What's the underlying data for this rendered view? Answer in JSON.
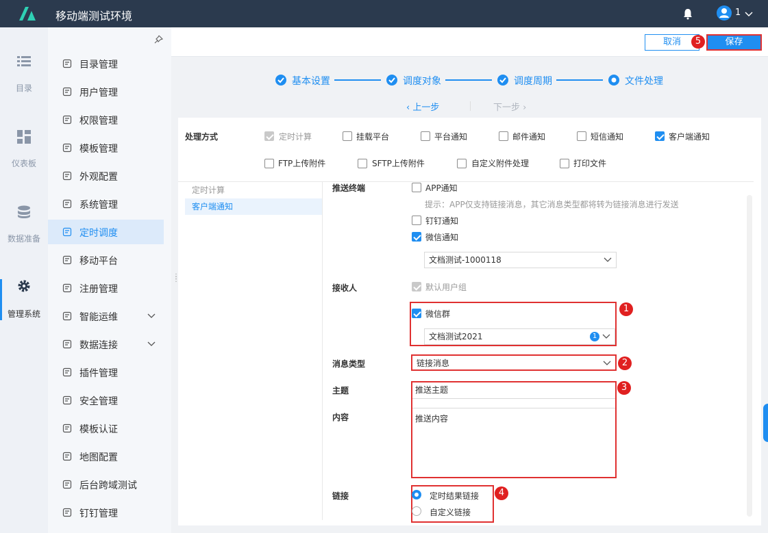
{
  "app": {
    "title": "移动端测试环境",
    "user": "1"
  },
  "rail": [
    {
      "label": "目录",
      "icon": "list-icon"
    },
    {
      "label": "仪表板",
      "icon": "dashboard-icon"
    },
    {
      "label": "数据准备",
      "icon": "database-icon"
    },
    {
      "label": "管理系统",
      "icon": "gear-icon",
      "active": true
    }
  ],
  "sidebar": {
    "items": [
      {
        "label": "目录管理"
      },
      {
        "label": "用户管理"
      },
      {
        "label": "权限管理"
      },
      {
        "label": "模板管理"
      },
      {
        "label": "外观配置"
      },
      {
        "label": "系统管理"
      },
      {
        "label": "定时调度",
        "active": true
      },
      {
        "label": "移动平台"
      },
      {
        "label": "注册管理"
      },
      {
        "label": "智能运维",
        "expandable": true
      },
      {
        "label": "数据连接",
        "expandable": true
      },
      {
        "label": "插件管理"
      },
      {
        "label": "安全管理"
      },
      {
        "label": "模板认证"
      },
      {
        "label": "地图配置"
      },
      {
        "label": "后台跨域测试"
      },
      {
        "label": "钉钉管理"
      }
    ]
  },
  "toolbar": {
    "cancel": "取消",
    "save": "保存"
  },
  "steps": [
    "基本设置",
    "调度对象",
    "调度周期",
    "文件处理"
  ],
  "nav": {
    "prev": "上一步",
    "next": "下一步"
  },
  "processing": {
    "label": "处理方式",
    "options": [
      {
        "label": "定时计算",
        "state": "disabled"
      },
      {
        "label": "挂载平台",
        "state": "off"
      },
      {
        "label": "平台通知",
        "state": "off"
      },
      {
        "label": "邮件通知",
        "state": "off"
      },
      {
        "label": "短信通知",
        "state": "off"
      },
      {
        "label": "客户端通知",
        "state": "on"
      },
      {
        "label": "FTP上传附件",
        "state": "off"
      },
      {
        "label": "SFTP上传附件",
        "state": "off"
      },
      {
        "label": "自定义附件处理",
        "state": "off"
      },
      {
        "label": "打印文件",
        "state": "off"
      }
    ]
  },
  "left_list": [
    "定时计算",
    "客户端通知"
  ],
  "form": {
    "terminal_label": "推送终端",
    "app_notify": "APP通知",
    "hint": "提示：APP仅支持链接消息，其它消息类型都将转为链接消息进行发送",
    "dingtalk_notify": "钉钉通知",
    "wechat_notify": "微信通知",
    "wechat_app": "文档测试-1000118",
    "receiver_label": "接收人",
    "default_group": "默认用户组",
    "wechat_group": "微信群",
    "group_value": "文档测试2021",
    "group_count": "1",
    "msg_type_label": "消息类型",
    "msg_type_value": "链接消息",
    "subject_label": "主题",
    "subject_value": "推送主题",
    "content_label": "内容",
    "content_value": "推送内容",
    "link_label": "链接",
    "link_result": "定时结果链接",
    "link_custom": "自定义链接"
  },
  "annotations": [
    "1",
    "2",
    "3",
    "4",
    "5"
  ],
  "colors": {
    "primary": "#1f8ef1",
    "topbar": "#2b3a4e",
    "annotation": "#e02020"
  }
}
